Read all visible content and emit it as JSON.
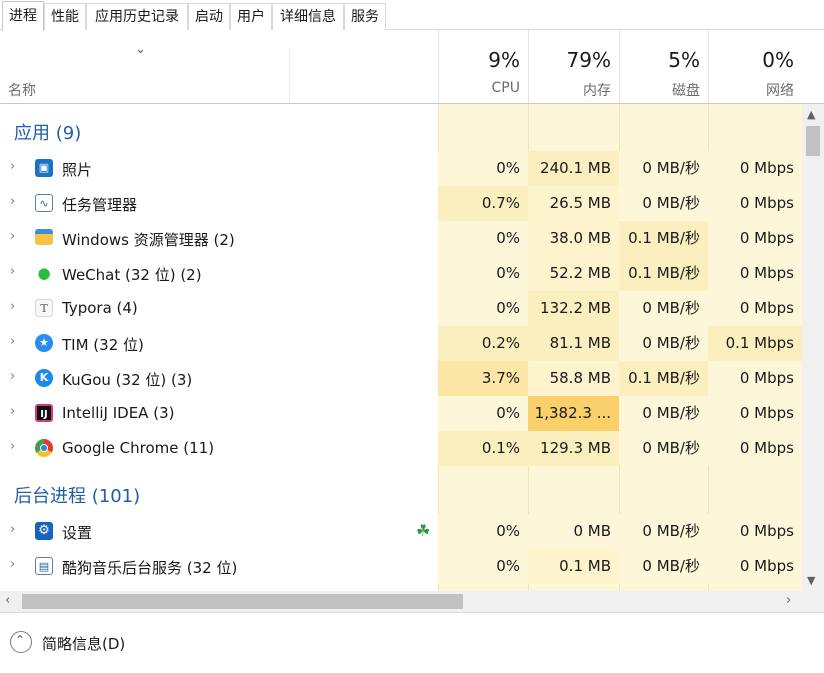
{
  "tabs": [
    {
      "label": "进程",
      "active": true
    },
    {
      "label": "性能",
      "active": false
    },
    {
      "label": "应用历史记录",
      "active": false
    },
    {
      "label": "启动",
      "active": false
    },
    {
      "label": "用户",
      "active": false
    },
    {
      "label": "详细信息",
      "active": false
    },
    {
      "label": "服务",
      "active": false
    }
  ],
  "header": {
    "sort_icon": "chevron-down-icon",
    "name_label": "名称",
    "columns": [
      {
        "percent": "9%",
        "label": "CPU"
      },
      {
        "percent": "79%",
        "label": "内存"
      },
      {
        "percent": "5%",
        "label": "磁盘"
      },
      {
        "percent": "0%",
        "label": "网络"
      }
    ]
  },
  "groups": [
    {
      "title": "应用 (9)",
      "rows": [
        {
          "name": "照片",
          "icon": "photos-icon",
          "cpu": "0%",
          "mem": "240.1 MB",
          "disk": "0 MB/秒",
          "net": "0 Mbps",
          "colors": [
            "#fdf6d9",
            "#fcefbf",
            "#fdf6d9",
            "#fdf6d9"
          ]
        },
        {
          "name": "任务管理器",
          "icon": "task-manager-icon",
          "cpu": "0.7%",
          "mem": "26.5 MB",
          "disk": "0 MB/秒",
          "net": "0 Mbps",
          "colors": [
            "#fcefbf",
            "#fdf3cd",
            "#fdf6d9",
            "#fdf6d9"
          ]
        },
        {
          "name": "Windows 资源管理器 (2)",
          "icon": "folder-icon",
          "cpu": "0%",
          "mem": "38.0 MB",
          "disk": "0.1 MB/秒",
          "net": "0 Mbps",
          "colors": [
            "#fdf6d9",
            "#fdf3cd",
            "#fcefbf",
            "#fdf6d9"
          ]
        },
        {
          "name": "WeChat (32 位) (2)",
          "icon": "wechat-icon",
          "cpu": "0%",
          "mem": "52.2 MB",
          "disk": "0.1 MB/秒",
          "net": "0 Mbps",
          "colors": [
            "#fdf6d9",
            "#fdf3cd",
            "#fcefbf",
            "#fdf6d9"
          ]
        },
        {
          "name": "Typora (4)",
          "icon": "typora-icon",
          "cpu": "0%",
          "mem": "132.2 MB",
          "disk": "0 MB/秒",
          "net": "0 Mbps",
          "colors": [
            "#fdf6d9",
            "#fcefbf",
            "#fdf6d9",
            "#fdf6d9"
          ]
        },
        {
          "name": "TIM (32 位)",
          "icon": "tim-icon",
          "cpu": "0.2%",
          "mem": "81.1 MB",
          "disk": "0 MB/秒",
          "net": "0.1 Mbps",
          "colors": [
            "#fcefbf",
            "#fcefbf",
            "#fdf6d9",
            "#fcefbf"
          ]
        },
        {
          "name": "KuGou (32 位) (3)",
          "icon": "kugou-icon",
          "cpu": "3.7%",
          "mem": "58.8 MB",
          "disk": "0.1 MB/秒",
          "net": "0 Mbps",
          "colors": [
            "#fbe6a6",
            "#fdf3cd",
            "#fcefbf",
            "#fdf6d9"
          ]
        },
        {
          "name": "IntelliJ IDEA (3)",
          "icon": "intellij-icon",
          "cpu": "0%",
          "mem": "1,382.3 ...",
          "disk": "0 MB/秒",
          "net": "0 Mbps",
          "colors": [
            "#fdf6d9",
            "#fad06b",
            "#fdf6d9",
            "#fdf6d9"
          ]
        },
        {
          "name": "Google Chrome (11)",
          "icon": "chrome-icon",
          "cpu": "0.1%",
          "mem": "129.3 MB",
          "disk": "0 MB/秒",
          "net": "0 Mbps",
          "colors": [
            "#fcefbf",
            "#fcefbf",
            "#fdf6d9",
            "#fdf6d9"
          ]
        }
      ]
    },
    {
      "title": "后台进程 (101)",
      "rows": [
        {
          "name": "设置",
          "icon": "settings-icon",
          "leaf": true,
          "cpu": "0%",
          "mem": "0 MB",
          "disk": "0 MB/秒",
          "net": "0 Mbps",
          "colors": [
            "#fdf6d9",
            "#fdf6d9",
            "#fdf6d9",
            "#fdf6d9"
          ]
        },
        {
          "name": "酷狗音乐后台服务 (32 位)",
          "icon": "kugou-service-icon",
          "cpu": "0%",
          "mem": "0.1 MB",
          "disk": "0 MB/秒",
          "net": "0 Mbps",
          "colors": [
            "#fdf6d9",
            "#fdf3cd",
            "#fdf6d9",
            "#fdf6d9"
          ]
        }
      ]
    }
  ],
  "footer": {
    "label": "简略信息(D)",
    "icon": "collapse-up-icon"
  },
  "colors": {
    "group_title": "#1f5ea8",
    "column_bg": "#fdf6d9",
    "high_memory": "#fad06b"
  }
}
